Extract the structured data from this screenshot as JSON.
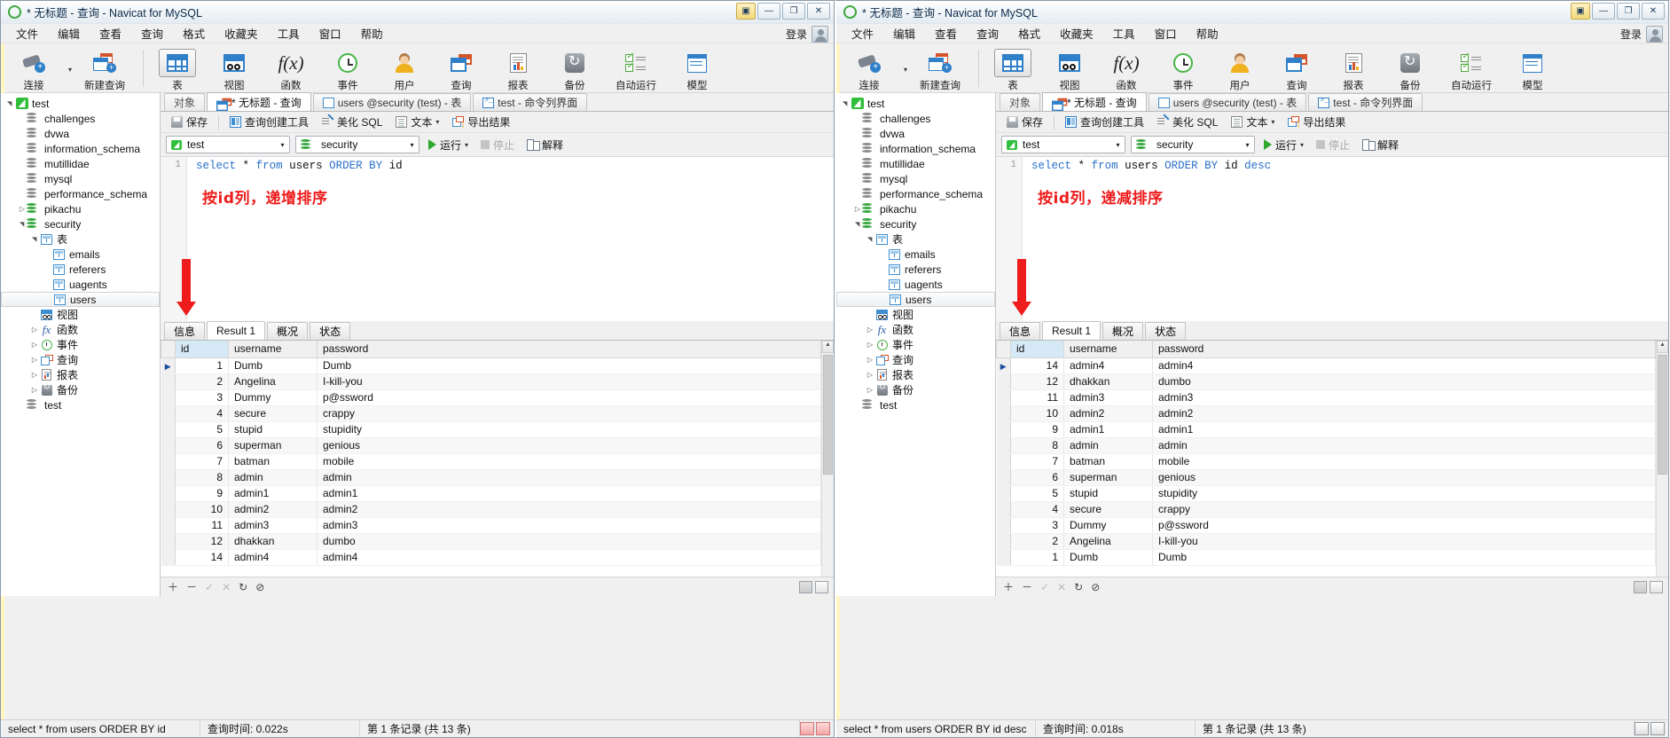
{
  "window": {
    "title": "* 无标题 - 查询 - Navicat for MySQL",
    "buttons": {
      "minimize": "—",
      "maximize": "❐",
      "close": "✕",
      "pin": "▣"
    }
  },
  "menubar": {
    "items": [
      "文件",
      "编辑",
      "查看",
      "查询",
      "格式",
      "收藏夹",
      "工具",
      "窗口",
      "帮助"
    ],
    "login_label": "登录"
  },
  "toolbar": {
    "items": [
      {
        "label": "连接",
        "icon": "connection-icon",
        "has_caret": true
      },
      {
        "label": "新建查询",
        "icon": "new-query-icon",
        "has_caret": false
      },
      {
        "label": "表",
        "icon": "table-icon",
        "active": true
      },
      {
        "label": "视图",
        "icon": "view-icon",
        "active": false
      },
      {
        "label": "函数",
        "icon": "function-icon",
        "active": false
      },
      {
        "label": "事件",
        "icon": "event-clock-icon",
        "active": false
      },
      {
        "label": "用户",
        "icon": "user-icon",
        "active": false
      },
      {
        "label": "查询",
        "icon": "query-icon",
        "active": false
      },
      {
        "label": "报表",
        "icon": "report-icon",
        "active": false
      },
      {
        "label": "备份",
        "icon": "backup-icon",
        "active": false
      },
      {
        "label": "自动运行",
        "icon": "automation-icon",
        "active": false
      },
      {
        "label": "模型",
        "icon": "model-icon",
        "active": false
      }
    ]
  },
  "sidebar": {
    "items": [
      {
        "label": "test",
        "icon": "connection-node-icon",
        "indent": 0,
        "expander": "open"
      },
      {
        "label": "challenges",
        "icon": "database-gray-icon",
        "indent": 1,
        "expander": "none"
      },
      {
        "label": "dvwa",
        "icon": "database-gray-icon",
        "indent": 1,
        "expander": "none"
      },
      {
        "label": "information_schema",
        "icon": "database-gray-icon",
        "indent": 1,
        "expander": "none"
      },
      {
        "label": "mutillidae",
        "icon": "database-gray-icon",
        "indent": 1,
        "expander": "none"
      },
      {
        "label": "mysql",
        "icon": "database-gray-icon",
        "indent": 1,
        "expander": "none"
      },
      {
        "label": "performance_schema",
        "icon": "database-gray-icon",
        "indent": 1,
        "expander": "none"
      },
      {
        "label": "pikachu",
        "icon": "database-green-icon",
        "indent": 1,
        "expander": "closed"
      },
      {
        "label": "security",
        "icon": "database-green-icon",
        "indent": 1,
        "expander": "open"
      },
      {
        "label": "表",
        "icon": "table-folder-icon",
        "indent": 2,
        "expander": "open"
      },
      {
        "label": "emails",
        "icon": "table-icon",
        "indent": 3,
        "expander": "none"
      },
      {
        "label": "referers",
        "icon": "table-icon",
        "indent": 3,
        "expander": "none"
      },
      {
        "label": "uagents",
        "icon": "table-icon",
        "indent": 3,
        "expander": "none"
      },
      {
        "label": "users",
        "icon": "table-icon",
        "indent": 3,
        "expander": "none",
        "selected": true
      },
      {
        "label": "视图",
        "icon": "view-icon",
        "indent": 2,
        "expander": "none"
      },
      {
        "label": "函数",
        "icon": "function-icon",
        "indent": 2,
        "expander": "closed"
      },
      {
        "label": "事件",
        "icon": "event-clock-icon",
        "indent": 2,
        "expander": "closed"
      },
      {
        "label": "查询",
        "icon": "query-icon",
        "indent": 2,
        "expander": "closed"
      },
      {
        "label": "报表",
        "icon": "report-icon",
        "indent": 2,
        "expander": "closed"
      },
      {
        "label": "备份",
        "icon": "backup-icon",
        "indent": 2,
        "expander": "closed"
      },
      {
        "label": "test",
        "icon": "database-gray-icon",
        "indent": 1,
        "expander": "none"
      }
    ]
  },
  "tabs": {
    "object": "对象",
    "items": [
      {
        "label": "* 无标题 - 查询",
        "icon": "query-icon",
        "active": true
      },
      {
        "label": "users @security (test) - 表",
        "icon": "table-icon",
        "active": false
      },
      {
        "label": "test - 命令列界面",
        "icon": "console-icon",
        "active": false
      }
    ]
  },
  "subtoolbar": {
    "save": "保存",
    "builder": "查询创建工具",
    "beautify": "美化 SQL",
    "text": "文本",
    "export": "导出结果"
  },
  "selectors": {
    "connection": "test",
    "database": "security",
    "run": "运行",
    "stop": "停止",
    "explain": "解释"
  },
  "editor_left": {
    "line_number": "1",
    "code_plain": "select * from users ORDER BY id",
    "annotation": "按id列，递增排序"
  },
  "editor_right": {
    "line_number": "1",
    "code_plain": "select * from users ORDER BY id desc",
    "annotation": "按id列，递减排序"
  },
  "result_tabs": {
    "items": [
      "信息",
      "Result 1",
      "概况",
      "状态"
    ],
    "active_index": 1
  },
  "grid": {
    "columns": [
      "id",
      "username",
      "password"
    ],
    "rows_left": [
      [
        "1",
        "Dumb",
        "Dumb"
      ],
      [
        "2",
        "Angelina",
        "I-kill-you"
      ],
      [
        "3",
        "Dummy",
        "p@ssword"
      ],
      [
        "4",
        "secure",
        "crappy"
      ],
      [
        "5",
        "stupid",
        "stupidity"
      ],
      [
        "6",
        "superman",
        "genious"
      ],
      [
        "7",
        "batman",
        "mobile"
      ],
      [
        "8",
        "admin",
        "admin"
      ],
      [
        "9",
        "admin1",
        "admin1"
      ],
      [
        "10",
        "admin2",
        "admin2"
      ],
      [
        "11",
        "admin3",
        "admin3"
      ],
      [
        "12",
        "dhakkan",
        "dumbo"
      ],
      [
        "14",
        "admin4",
        "admin4"
      ]
    ],
    "rows_right": [
      [
        "14",
        "admin4",
        "admin4"
      ],
      [
        "12",
        "dhakkan",
        "dumbo"
      ],
      [
        "11",
        "admin3",
        "admin3"
      ],
      [
        "10",
        "admin2",
        "admin2"
      ],
      [
        "9",
        "admin1",
        "admin1"
      ],
      [
        "8",
        "admin",
        "admin"
      ],
      [
        "7",
        "batman",
        "mobile"
      ],
      [
        "6",
        "superman",
        "genious"
      ],
      [
        "5",
        "stupid",
        "stupidity"
      ],
      [
        "4",
        "secure",
        "crappy"
      ],
      [
        "3",
        "Dummy",
        "p@ssword"
      ],
      [
        "2",
        "Angelina",
        "I-kill-you"
      ],
      [
        "1",
        "Dumb",
        "Dumb"
      ]
    ]
  },
  "statusbar_left": {
    "sql": "select * from users ORDER BY id",
    "time": "查询时间: 0.022s",
    "records": "第 1 条记录 (共 13 条)"
  },
  "statusbar_right": {
    "sql": "select * from users ORDER BY id desc",
    "time": "查询时间: 0.018s",
    "records": "第 1 条记录 (共 13 条)"
  },
  "colors": {
    "accent_blue": "#2f80c9",
    "annotation_red": "#ee1c1c",
    "id_header": "#d6e9f7",
    "green": "#3aa843"
  }
}
